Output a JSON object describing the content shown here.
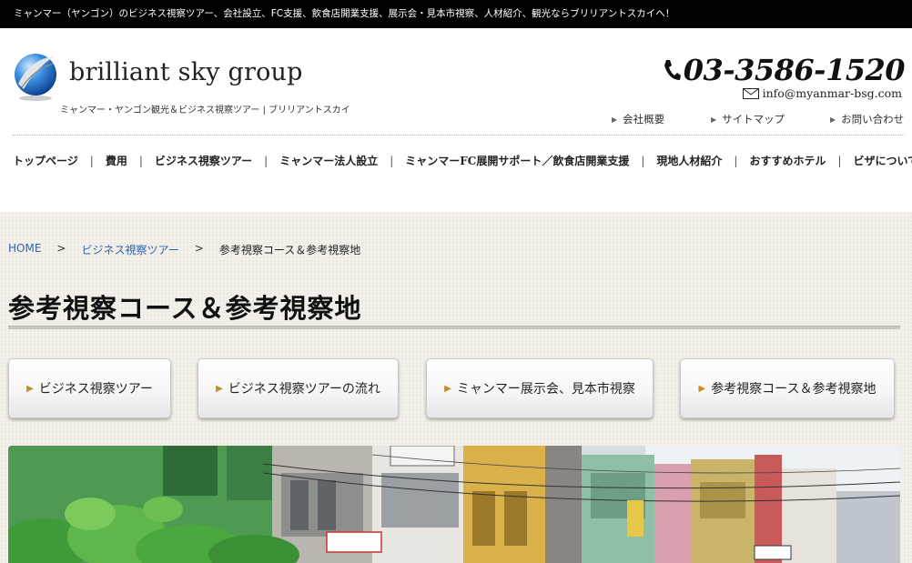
{
  "topbar": {
    "text": "ミャンマー（ヤンゴン）のビジネス視察ツアー、会社設立、FC支援、飲食店開業支援、展示会・見本市視察、人材紹介、観光ならブリリアントスカイへ！"
  },
  "header": {
    "brand": "brilliant sky group",
    "tagline": "ミャンマー・ヤンゴン観光＆ビジネス視察ツアー | ブリリアントスカイ",
    "phone": "03-3586-1520",
    "email": "info@myanmar-bsg.com"
  },
  "utility_nav": [
    {
      "label": "会社概要"
    },
    {
      "label": "サイトマップ"
    },
    {
      "label": "お問い合わせ"
    }
  ],
  "global_nav": [
    {
      "label": "トップページ"
    },
    {
      "label": "費用"
    },
    {
      "label": "ビジネス視察ツアー"
    },
    {
      "label": "ミャンマー法人設立"
    },
    {
      "label": "ミャンマーFC展開サポート／飲食店開業支援"
    },
    {
      "label": "現地人材紹介"
    },
    {
      "label": "おすすめホテル"
    },
    {
      "label": "ビザについて"
    }
  ],
  "global_nav_separator": "|",
  "breadcrumb": {
    "home": "HOME",
    "parent": "ビジネス視察ツアー",
    "current": "参考視察コース＆参考視察地",
    "separator": ">"
  },
  "page": {
    "title": "参考視察コース＆参考視察地"
  },
  "subnav": [
    {
      "label": "ビジネス視察ツアー"
    },
    {
      "label": "ビジネス視察ツアーの流れ"
    },
    {
      "label": "ミャンマー展示会、見本市視察"
    },
    {
      "label": "参考視察コース＆参考視察地"
    }
  ],
  "icons": {
    "logo": "sphere-logo-icon",
    "phone": "phone-icon",
    "mail": "envelope-icon",
    "arrow": "triangle-right-icon"
  },
  "colors": {
    "topbar_bg": "#000000",
    "link": "#2f64b3",
    "button_arrow": "#c98a2a",
    "content_bg": "#f2f0e8"
  }
}
